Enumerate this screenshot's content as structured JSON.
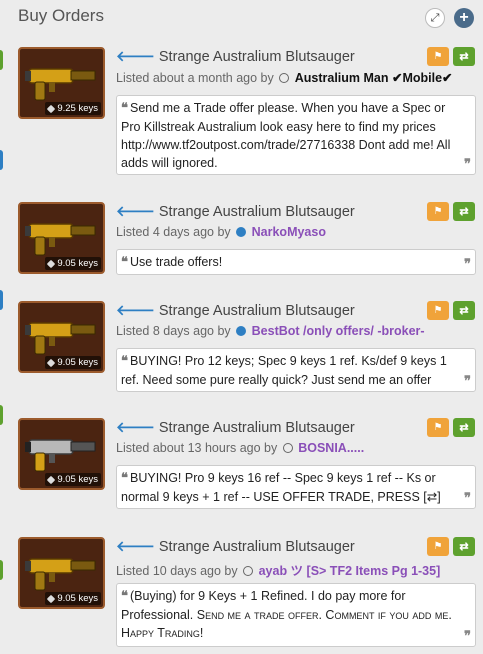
{
  "header": {
    "title": "Buy Orders",
    "expand_icon": "expand-icon",
    "add_icon": "plus-icon"
  },
  "colors": {
    "orange": "#f0a33a",
    "green": "#5ea12e",
    "link_blue": "#2e7fc3",
    "purple": "#8a4fb8"
  },
  "orders": [
    {
      "item": "Strange Australium Blutsauger",
      "price": "9.25 keys",
      "listed": "Listed about a month ago by",
      "status": "offline",
      "user": "Australium Man ✔Mobile✔",
      "msg_a": "Send me a Trade offer please. When you have a Spec or Pro Killstreak Australium look easy here to find my prices http://www.tf2outpost.com/trade/27716338 Dont add me! All adds will ignored.",
      "msg_b": ""
    },
    {
      "item": "Strange Australium Blutsauger",
      "price": "9.05 keys",
      "listed": "Listed 4 days ago by",
      "status": "online",
      "user": "NarkoMyaso",
      "msg_a": "Use trade offers!",
      "msg_b": ""
    },
    {
      "item": "Strange Australium Blutsauger",
      "price": "9.05 keys",
      "listed": "Listed 8 days ago by",
      "status": "online",
      "user": "BestBot /only offers/ -broker-",
      "msg_a": "BUYING! Pro 12 keys; Spec 9 keys 1 ref. Ks/def 9 keys 1 ref. Need some pure really quick? Just send me an offer",
      "msg_b": ""
    },
    {
      "item": "Strange Australium Blutsauger",
      "price": "9.05 keys",
      "listed": "Listed about 13 hours ago by",
      "status": "offline",
      "user": "BOSNIA.....",
      "msg_a": "BUYING! Pro 9 keys 16 ref -- Spec 9 keys 1 ref -- Ks or normal 9 keys + 1 ref -- USE OFFER TRADE, PRESS [⇄]",
      "msg_b": ""
    },
    {
      "item": "Strange Australium Blutsauger",
      "price": "9.05 keys",
      "listed": "Listed 10 days ago by",
      "status": "offline",
      "user": "ayab ツ [S> TF2 Items Pg 1-35]",
      "msg_a": "(Buying) for 9 Keys + 1 Refined. I do pay more for Professional. ",
      "msg_b": "Send me a trade offer. Comment if you add me. Happy Trading!"
    }
  ]
}
